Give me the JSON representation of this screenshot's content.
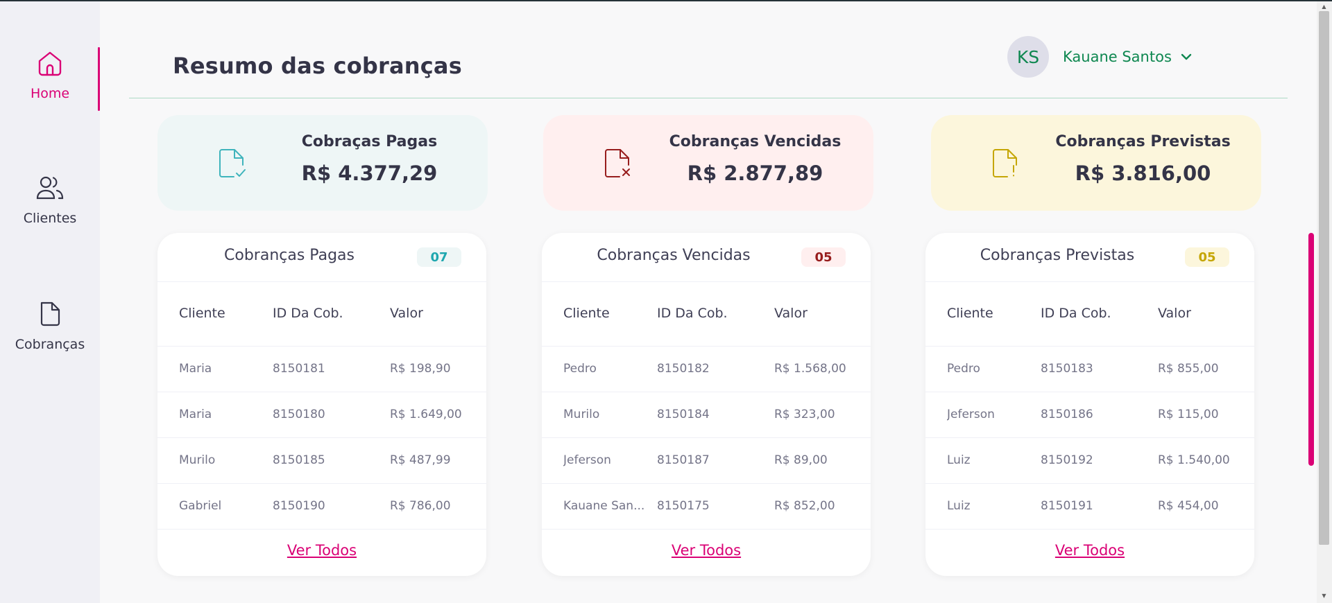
{
  "sidebar": {
    "items": [
      {
        "label": "Home",
        "icon": "home-icon",
        "active": true
      },
      {
        "label": "Clientes",
        "icon": "users-icon",
        "active": false
      },
      {
        "label": "Cobranças",
        "icon": "document-icon",
        "active": false
      }
    ]
  },
  "header": {
    "title": "Resumo das cobranças",
    "user": {
      "initials": "KS",
      "name": "Kauane Santos"
    }
  },
  "summary": {
    "paid": {
      "title": "Cobraças Pagas",
      "value": "R$ 4.377,29"
    },
    "late": {
      "title": "Cobranças Vencidas",
      "value": "R$ 2.877,89"
    },
    "pending": {
      "title": "Cobranças Previstas",
      "value": "R$ 3.816,00"
    }
  },
  "columns": {
    "client": "Cliente",
    "id": "ID Da Cob.",
    "value": "Valor"
  },
  "tables": {
    "paid": {
      "title": "Cobranças Pagas",
      "count": "07",
      "rows": [
        {
          "client": "Maria",
          "id": "8150181",
          "value": "R$ 198,90"
        },
        {
          "client": "Maria",
          "id": "8150180",
          "value": "R$ 1.649,00"
        },
        {
          "client": "Murilo",
          "id": "8150185",
          "value": "R$ 487,99"
        },
        {
          "client": "Gabriel",
          "id": "8150190",
          "value": "R$ 786,00"
        }
      ],
      "link": "Ver Todos"
    },
    "late": {
      "title": "Cobranças Vencidas",
      "count": "05",
      "rows": [
        {
          "client": "Pedro",
          "id": "8150182",
          "value": "R$ 1.568,00"
        },
        {
          "client": "Murilo",
          "id": "8150184",
          "value": "R$ 323,00"
        },
        {
          "client": "Jeferson",
          "id": "8150187",
          "value": "R$ 89,00"
        },
        {
          "client": "Kauane San...",
          "id": "8150175",
          "value": "R$ 852,00"
        }
      ],
      "link": "Ver Todos"
    },
    "pending": {
      "title": "Cobranças Previstas",
      "count": "05",
      "rows": [
        {
          "client": "Pedro",
          "id": "8150183",
          "value": "R$ 855,00"
        },
        {
          "client": "Jeferson",
          "id": "8150186",
          "value": "R$ 115,00"
        },
        {
          "client": "Luiz",
          "id": "8150192",
          "value": "R$ 1.540,00"
        },
        {
          "client": "Luiz",
          "id": "8150191",
          "value": "R$ 454,00"
        }
      ],
      "link": "Ver Todos"
    }
  },
  "colors": {
    "accent": "#da0175",
    "green": "#0e8750",
    "paid": "#1fa7af",
    "late": "#971d1d",
    "pending": "#c5a605"
  }
}
